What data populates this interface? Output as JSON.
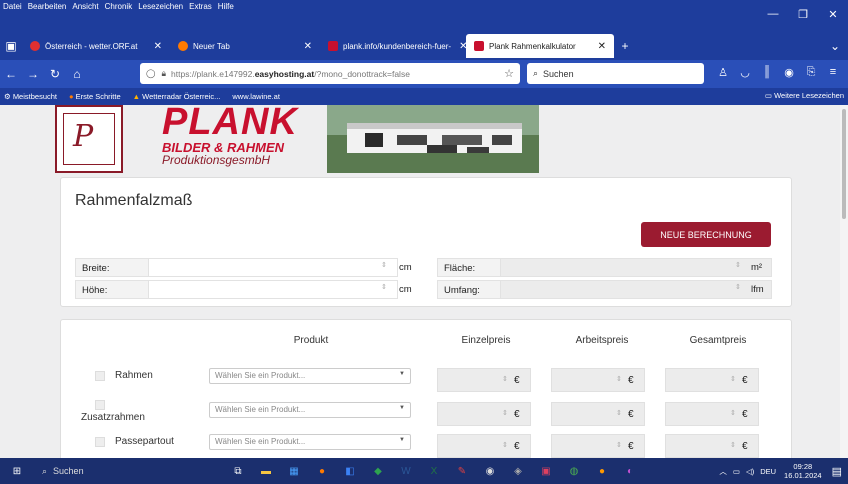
{
  "menubar": {
    "items": [
      "Datei",
      "Bearbeiten",
      "Ansicht",
      "Chronik",
      "Lesezeichen",
      "Extras",
      "Hilfe"
    ]
  },
  "tabs": [
    {
      "label": "Österreich - wetter.ORF.at",
      "color": "#e03030"
    },
    {
      "label": "Neuer Tab",
      "color": "#ff7a00"
    },
    {
      "label": "plank.info/kundenbereich-fuer-",
      "color": "#c8102e"
    },
    {
      "label": "Plank Rahmenkalkulator",
      "color": "#c8102e"
    }
  ],
  "nav": {
    "url_prefix": "https://plank.e147992.",
    "url_domain": "easyhosting.at",
    "url_suffix": "/?mono_donottrack=false",
    "search_placeholder": "Suchen"
  },
  "bookmarks": {
    "items": [
      "Meistbesucht",
      "Erste Schritte",
      "Wetterradar Österreic...",
      "www.lawine.at"
    ],
    "right": "Weitere Lesezeichen"
  },
  "brand": {
    "logo_letter": "P",
    "name": "PLANK",
    "line2": "BILDER & RAHMEN",
    "line3": "ProduktionsgesmbH"
  },
  "calc": {
    "title": "Rahmenfalzmaß",
    "new_button": "NEUE BERECHNUNG",
    "fields": [
      {
        "label": "Breite:",
        "unit": "cm",
        "right_label": "Fläche:",
        "right_unit": "m²"
      },
      {
        "label": "Höhe:",
        "unit": "cm",
        "right_label": "Umfang:",
        "right_unit": "lfm"
      }
    ]
  },
  "products": {
    "headers": {
      "product": "Produkt",
      "single": "Einzelpreis",
      "work": "Arbeitspreis",
      "total": "Gesamtpreis"
    },
    "select_placeholder": "Wählen Sie ein Produkt...",
    "currency": "€",
    "rows": [
      "Rahmen",
      "Zusatzrahmen",
      "Passepartout"
    ]
  },
  "taskbar": {
    "search": "Suchen",
    "lang": "DEU",
    "time": "09:28",
    "date": "16.01.2024"
  },
  "colors": {
    "accent": "#9b1b30",
    "brand_red": "#c8102e",
    "browser_blue": "#1e3d9c"
  }
}
